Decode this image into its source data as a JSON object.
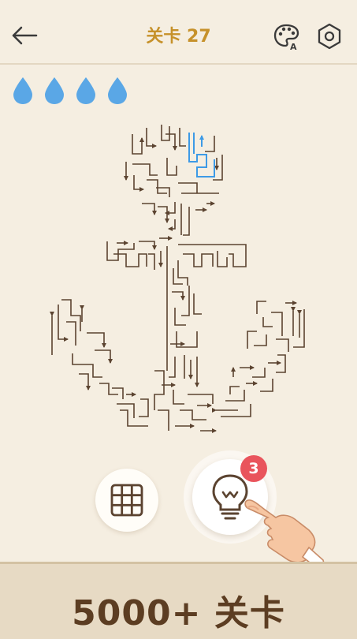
{
  "header": {
    "back_icon": "arrow-left-icon",
    "title": "关卡 27",
    "title_color": "#c6912a",
    "theme_icon": "palette-icon",
    "settings_icon": "hexagon-gear-icon"
  },
  "lives": {
    "icon": "water-drop-icon",
    "count": 4,
    "color": "#5aa7e6"
  },
  "maze": {
    "shape": "anchor",
    "line_color": "#5b4330",
    "active_color": "#3d9ae6"
  },
  "controls": {
    "grid_icon": "grid-icon",
    "hint_icon": "lightbulb-icon",
    "hint_count": "3",
    "badge_color": "#e9545c"
  },
  "footer": {
    "text": "5000+ 关卡"
  }
}
